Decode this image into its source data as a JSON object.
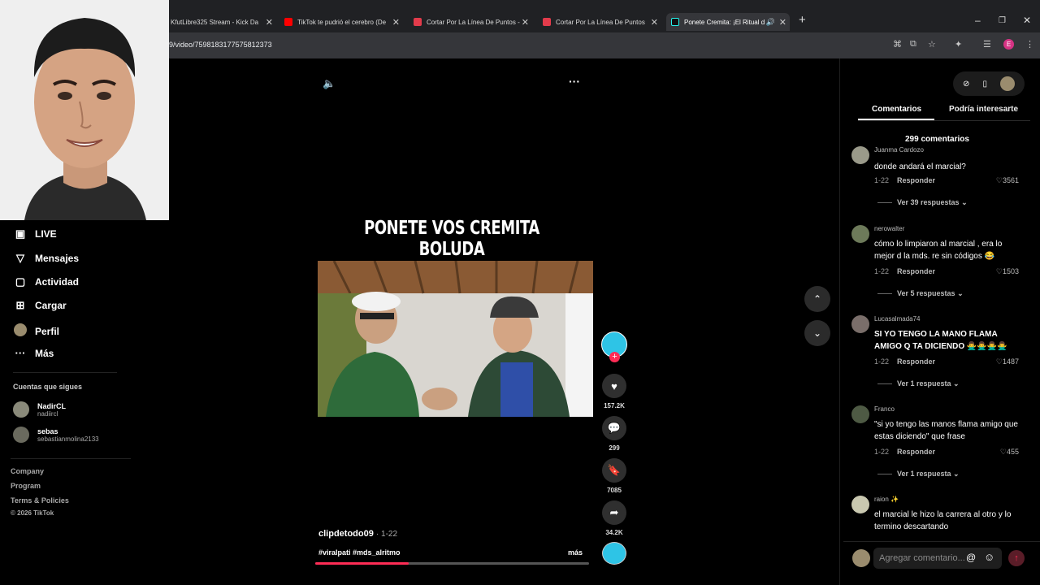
{
  "browser": {
    "tabs": [
      {
        "title": "KfutLibre325 Stream - Kick Da",
        "fav_color": "#53fc18"
      },
      {
        "title": "TikTok te pudrió el cerebro (De",
        "fav_color": "#ff0000"
      },
      {
        "title": "Cortar Por La Línea De Puntos -",
        "fav_color": "#e33b4b"
      },
      {
        "title": "Cortar Por La Línea De Puntos",
        "fav_color": "#e33b4b"
      },
      {
        "title": "Ponete Cremita: ¡El Ritual d",
        "fav_color": "#000000"
      }
    ],
    "url": "9/video/7598183177575812373",
    "profile_initial": "E"
  },
  "sidebar": {
    "nav": [
      {
        "label": "LIVE",
        "icon": "live-icon"
      },
      {
        "label": "Mensajes",
        "icon": "messages-icon"
      },
      {
        "label": "Actividad",
        "icon": "activity-icon"
      },
      {
        "label": "Cargar",
        "icon": "upload-icon"
      },
      {
        "label": "Perfil",
        "icon": "profile-avatar"
      },
      {
        "label": "Más",
        "icon": "more-icon"
      }
    ],
    "following_title": "Cuentas que sigues",
    "following": [
      {
        "name": "NadirCL",
        "handle": "nadiircl"
      },
      {
        "name": "sebas",
        "handle": "sebastianmolina2133"
      }
    ],
    "footer": [
      "Company",
      "Program",
      "Terms & Policies",
      "© 2026 TikTok"
    ]
  },
  "video": {
    "title": "PONETE VOS CREMITA BOLUDA",
    "author": "clipdetodo09",
    "date": "· 1-22",
    "hashtags": "#viralpati #mds_alritmo",
    "more_label": "más",
    "progress": 0.34,
    "likes": "157.2K",
    "comments": "299",
    "saves": "7085",
    "shares": "34.2K"
  },
  "comments_panel": {
    "tab_active": "Comentarios",
    "tab_other": "Podría interesarte",
    "count_label": "299 comentarios",
    "reply_label": "Responder",
    "input_placeholder": "Agregar comentario...",
    "items": [
      {
        "user": "Juanma Cardozo",
        "text": "donde andará el marcial?",
        "date": "1-22",
        "likes": "3561",
        "replies": "Ver 39 respuestas",
        "avatar": "#9a9a8a"
      },
      {
        "user": "nerowalter",
        "text": "cómo lo limpiaron al marcial , era lo mejor d la mds. re sin códigos 😂",
        "date": "1-22",
        "likes": "1503",
        "replies": "Ver 5 respuestas",
        "avatar": "#6d7a5a"
      },
      {
        "user": "Lucasalmada74",
        "text": "SI YO TENGO LA MANO FLAMA AMIGO Q TA DICIENDO 🙅‍♂️🙅‍♂️🙅‍♂️🙅‍♂️",
        "date": "1-22",
        "likes": "1487",
        "replies": "Ver 1 respuesta",
        "avatar": "#7a6e6a"
      },
      {
        "user": "Franco",
        "text": "\"si yo tengo las manos flama amigo que estas diciendo\" que frase",
        "date": "1-22",
        "likes": "455",
        "replies": "Ver 1 respuesta",
        "avatar": "#4e5a44"
      },
      {
        "user": "raion ✨",
        "text": "el marcial le hizo la carrera al otro y lo termino descartando",
        "date": "",
        "likes": "",
        "replies": "",
        "avatar": "#c9c8b0"
      }
    ]
  }
}
